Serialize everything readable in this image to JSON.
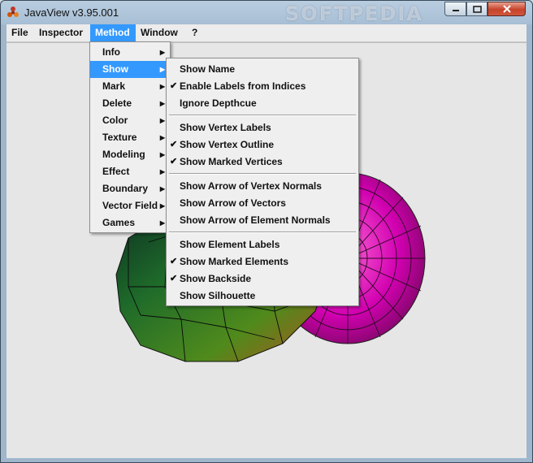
{
  "window": {
    "title": "JavaView v3.95.001",
    "watermark": "SOFTPEDIA",
    "accent": "#3399ff"
  },
  "menubar": [
    {
      "label": "File"
    },
    {
      "label": "Inspector"
    },
    {
      "label": "Method",
      "active": true
    },
    {
      "label": "Window"
    },
    {
      "label": "?"
    }
  ],
  "method_menu": {
    "items": [
      {
        "label": "Info",
        "has_submenu": true
      },
      {
        "label": "Show",
        "has_submenu": true,
        "highlighted": true
      },
      {
        "label": "Mark",
        "has_submenu": true
      },
      {
        "label": "Delete",
        "has_submenu": true
      },
      {
        "label": "Color",
        "has_submenu": true
      },
      {
        "label": "Texture",
        "has_submenu": true
      },
      {
        "label": "Modeling",
        "has_submenu": true
      },
      {
        "label": "Effect",
        "has_submenu": true
      },
      {
        "label": "Boundary",
        "has_submenu": true
      },
      {
        "label": "Vector Field",
        "has_submenu": true
      },
      {
        "label": "Games",
        "has_submenu": true
      }
    ]
  },
  "show_menu": {
    "groups": [
      [
        {
          "label": "Show Name",
          "checked": false
        },
        {
          "label": "Enable Labels from Indices",
          "checked": true
        },
        {
          "label": "Ignore Depthcue",
          "checked": false
        }
      ],
      [
        {
          "label": "Show Vertex Labels",
          "checked": false
        },
        {
          "label": "Show Vertex Outline",
          "checked": true
        },
        {
          "label": "Show Marked Vertices",
          "checked": true
        }
      ],
      [
        {
          "label": "Show Arrow of Vertex Normals",
          "checked": false
        },
        {
          "label": "Show Arrow of Vectors",
          "checked": false
        },
        {
          "label": "Show Arrow of Element Normals",
          "checked": false
        }
      ],
      [
        {
          "label": "Show Element Labels",
          "checked": false
        },
        {
          "label": "Show Marked Elements",
          "checked": true
        },
        {
          "label": "Show Backside",
          "checked": true
        },
        {
          "label": "Show Silhouette",
          "checked": false
        }
      ]
    ]
  }
}
